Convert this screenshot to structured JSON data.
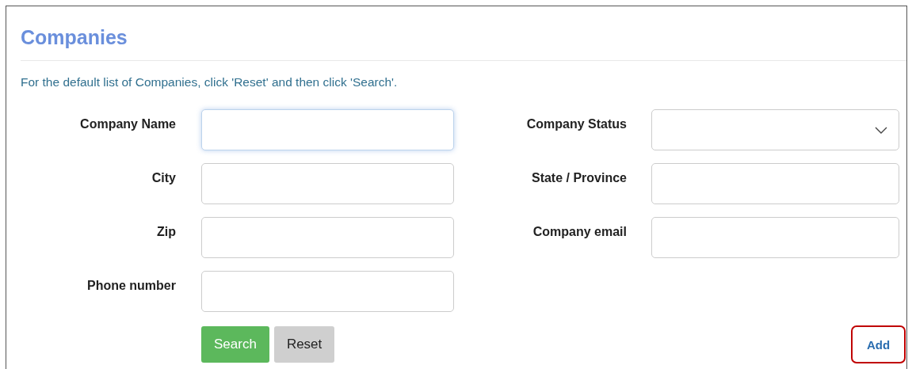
{
  "title": "Companies",
  "hint": "For the default list of Companies, click 'Reset' and then click 'Search'.",
  "rows": [
    [
      {
        "label": "Company Name",
        "kind": "text",
        "focused": true
      },
      {
        "label": "Company Status",
        "kind": "select",
        "focused": false
      }
    ],
    [
      {
        "label": "City",
        "kind": "text",
        "focused": false
      },
      {
        "label": "State / Province",
        "kind": "text",
        "focused": false
      }
    ],
    [
      {
        "label": "Zip",
        "kind": "text",
        "focused": false
      },
      {
        "label": "Company email",
        "kind": "text",
        "focused": false
      }
    ],
    [
      {
        "label": "Phone number",
        "kind": "text",
        "focused": false
      }
    ]
  ],
  "buttons": [
    {
      "label": "Search",
      "kind": "primary"
    },
    {
      "label": "Reset",
      "kind": "default"
    }
  ],
  "add_button": {
    "label": "Add",
    "highlighted": true
  }
}
